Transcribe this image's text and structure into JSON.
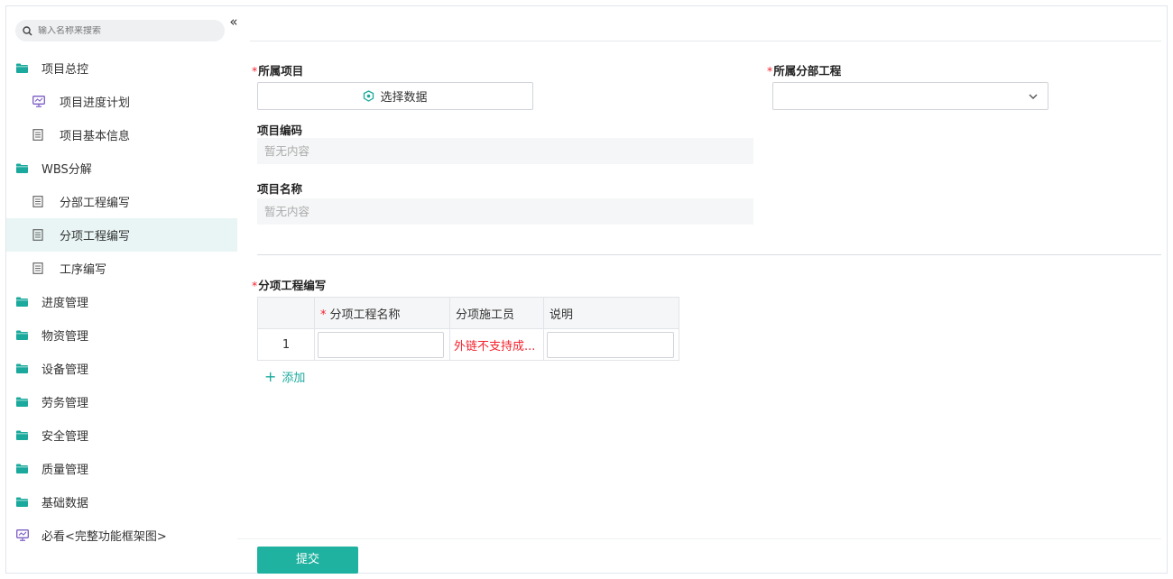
{
  "sidebar": {
    "search_placeholder": "输入名称来搜索",
    "collapse_glyph": "«",
    "items": [
      {
        "label": "项目总控",
        "icon": "folder-icon",
        "level": 0
      },
      {
        "label": "项目进度计划",
        "icon": "monitor-icon",
        "level": 1
      },
      {
        "label": "项目基本信息",
        "icon": "document-icon",
        "level": 1
      },
      {
        "label": "WBS分解",
        "icon": "folder-icon",
        "level": 0
      },
      {
        "label": "分部工程编写",
        "icon": "document-icon",
        "level": 1
      },
      {
        "label": "分项工程编写",
        "icon": "document-icon",
        "level": 1,
        "active": true
      },
      {
        "label": "工序编写",
        "icon": "document-icon",
        "level": 1
      },
      {
        "label": "进度管理",
        "icon": "folder-icon",
        "level": 0
      },
      {
        "label": "物资管理",
        "icon": "folder-icon",
        "level": 0
      },
      {
        "label": "设备管理",
        "icon": "folder-icon",
        "level": 0
      },
      {
        "label": "劳务管理",
        "icon": "folder-icon",
        "level": 0
      },
      {
        "label": "安全管理",
        "icon": "folder-icon",
        "level": 0
      },
      {
        "label": "质量管理",
        "icon": "folder-icon",
        "level": 0
      },
      {
        "label": "基础数据",
        "icon": "folder-icon",
        "level": 0
      },
      {
        "label": "必看<完整功能框架图>",
        "icon": "monitor-icon",
        "level": 0
      }
    ]
  },
  "form": {
    "project_label": "所属项目",
    "select_data_label": "选择数据",
    "division_label": "所属分部工程",
    "project_code_label": "项目编码",
    "project_code_value": "暂无内容",
    "project_name_label": "项目名称",
    "project_name_value": "暂无内容",
    "sub_item_label": "分项工程编写",
    "required_mark": "*"
  },
  "table": {
    "columns": [
      "",
      "分项工程名称",
      "分项施工员",
      "说明"
    ],
    "rows": [
      {
        "index": "1",
        "staff_text": "外链不支持成..."
      }
    ]
  },
  "actions": {
    "add_label": "添加",
    "add_glyph": "+",
    "submit_label": "提交"
  },
  "colors": {
    "accent": "#20b2a0",
    "required": "#f5222d",
    "folder": "#1aa99c",
    "active_bg": "#e8f5f4"
  }
}
